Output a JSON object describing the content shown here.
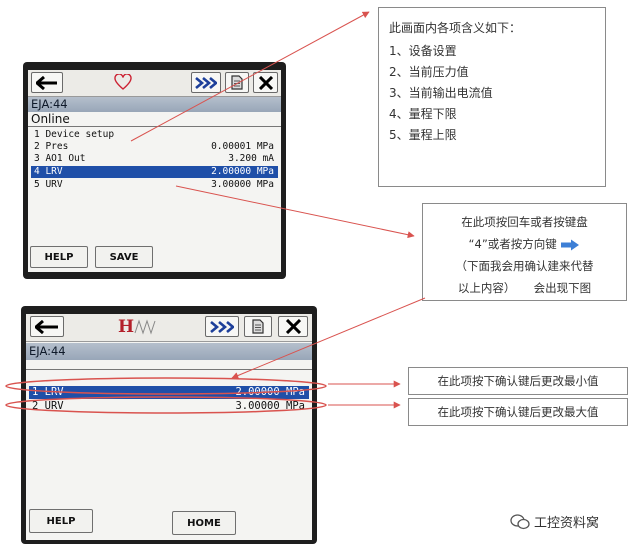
{
  "screen1": {
    "tag": "EJA:44",
    "status": "Online",
    "rows": [
      {
        "label": "1 Device setup",
        "value": ""
      },
      {
        "label": "2 Pres",
        "value": "0.00001 MPa"
      },
      {
        "label": "3 AO1 Out",
        "value": "3.200 mA"
      },
      {
        "label": "4 LRV",
        "value": "2.00000 MPa"
      },
      {
        "label": "5 URV",
        "value": "3.00000 MPa"
      }
    ],
    "softkeys": [
      "HELP",
      "SAVE"
    ],
    "icons": [
      "back-arrow-icon",
      "heart-icon",
      "fast-forward-icon",
      "document-icon",
      "close-icon"
    ]
  },
  "screen2": {
    "tag": "EJA:44",
    "rows": [
      {
        "label": "1 LRV",
        "value": "2.00000 MPa"
      },
      {
        "label": "2 URV",
        "value": "3.00000 MPa"
      }
    ],
    "softkeys": [
      "HELP",
      "HOME"
    ],
    "icons": [
      "back-arrow-icon",
      "hart-logo-icon",
      "fast-forward-icon",
      "document-icon",
      "close-icon"
    ],
    "logo_text": "H"
  },
  "legend": {
    "title": "此画面内各项含义如下：",
    "items": [
      "1、设备设置",
      "2、当前压力值",
      "3、当前输出电流值",
      "4、量程下限",
      "5、量程上限"
    ]
  },
  "note": {
    "line1": "在此项按回车或者按键盘",
    "line2": "“4”或者按方向键",
    "line3": "（下面我会用确认建来代替",
    "line4": "以上内容）",
    "line4b": "会出现下图"
  },
  "tips": {
    "lrv": "在此项按下确认键后更改最小值",
    "urv": "在此项按下确认键后更改最大值"
  },
  "watermark": "工控资料窝",
  "colors": {
    "selection": "#1f4fa8",
    "callout_line": "#d9534f",
    "arrow_blue": "#3d7fd6"
  }
}
